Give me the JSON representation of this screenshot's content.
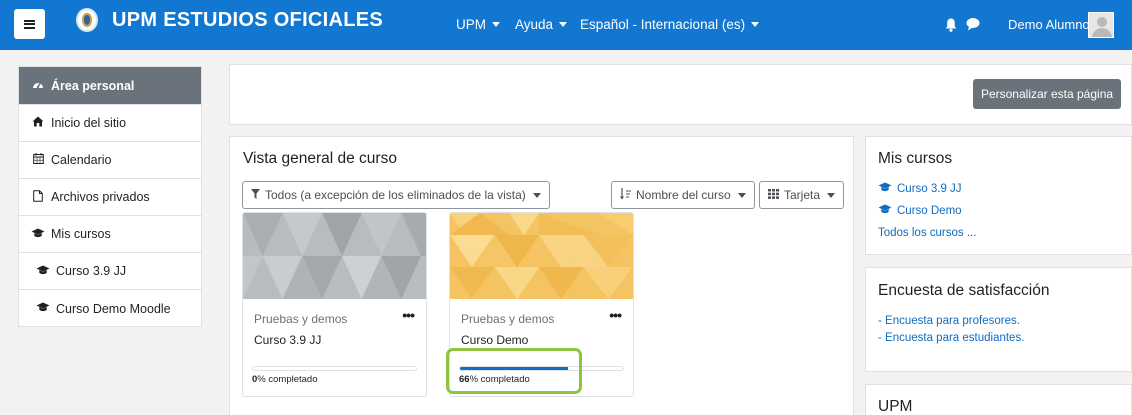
{
  "navbar": {
    "site_name": "UPM ESTUDIOS OFICIALES",
    "menus": [
      {
        "label": "UPM"
      },
      {
        "label": "Ayuda"
      },
      {
        "label": "Español - Internacional (es)"
      }
    ],
    "user_name": "Demo Alumno",
    "icons": [
      "hamburger-icon",
      "upm-logo",
      "bell-icon",
      "chat-icon",
      "user-avatar"
    ]
  },
  "sidebar": {
    "items": [
      {
        "label": "Área personal",
        "icon": "dashboard-icon",
        "active": true
      },
      {
        "label": "Inicio del sitio",
        "icon": "home-icon"
      },
      {
        "label": "Calendario",
        "icon": "calendar-icon"
      },
      {
        "label": "Archivos privados",
        "icon": "file-icon"
      },
      {
        "label": "Mis cursos",
        "icon": "graduation-cap-icon"
      },
      {
        "label": "Curso 3.9 JJ",
        "icon": "graduation-cap-icon"
      },
      {
        "label": "Curso Demo Moodle",
        "icon": "graduation-cap-icon"
      }
    ]
  },
  "header": {
    "customize_button": "Personalizar esta página"
  },
  "overview": {
    "title": "Vista general de curso",
    "filter": "Todos (a excepción de los eliminados de la vista)",
    "sort": "Nombre del curso",
    "view": "Tarjeta",
    "courses": [
      {
        "category": "Pruebas y demos",
        "name": "Curso 3.9 JJ",
        "progress_pct": "0",
        "progress_suffix": "% completado",
        "progress_fraction": 0.0,
        "menu": "•••"
      },
      {
        "category": "Pruebas y demos",
        "name": "Curso Demo",
        "progress_pct": "66",
        "progress_suffix": "% completado",
        "progress_fraction": 0.66,
        "menu": "•••"
      }
    ]
  },
  "mis_cursos": {
    "title": "Mis cursos",
    "links": [
      "Curso 3.9 JJ",
      "Curso Demo"
    ],
    "all_link": "Todos los cursos ..."
  },
  "encuesta": {
    "title": "Encuesta de satisfacción",
    "links": [
      "- Encuesta para profesores.",
      "- Encuesta para estudiantes."
    ]
  },
  "upm_block": {
    "title": "UPM"
  },
  "colors": {
    "navbar": "#1177d1",
    "sidebar_active": "#6a737b",
    "link": "#0f6cbf",
    "progress": "#0f6fc5",
    "highlight": "#8cc63f"
  }
}
